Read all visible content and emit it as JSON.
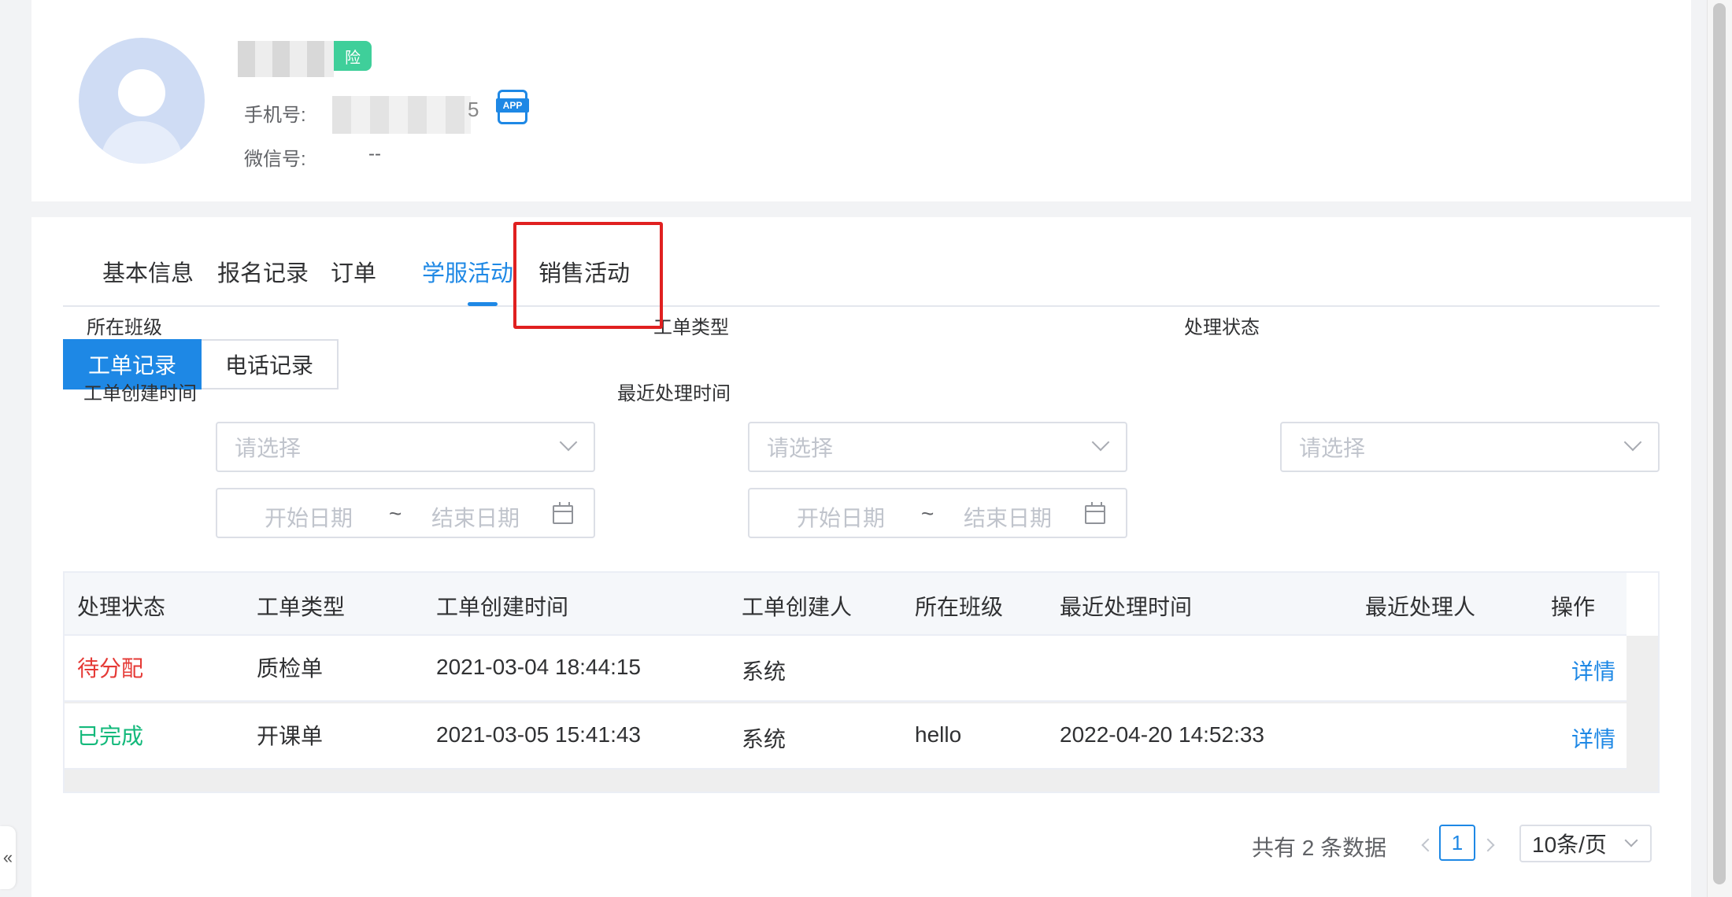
{
  "profile": {
    "name_badge": "险",
    "phone_label": "手机号:",
    "phone_tail": "5",
    "app_badge": "APP",
    "wechat_label": "微信号:",
    "wechat_value": "--"
  },
  "tabs": [
    {
      "label": "基本信息",
      "active": false
    },
    {
      "label": "报名记录",
      "active": false
    },
    {
      "label": "订单",
      "active": false
    },
    {
      "label": "学服活动",
      "active": true
    },
    {
      "label": "销售活动",
      "active": false
    }
  ],
  "segments": [
    {
      "label": "工单记录",
      "active": true
    },
    {
      "label": "电话记录",
      "active": false
    }
  ],
  "filters": {
    "class_label": "所在班级",
    "class_placeholder": "请选择",
    "type_label": "工单类型",
    "type_placeholder": "请选择",
    "status_label": "处理状态",
    "status_placeholder": "请选择",
    "created_label": "工单创建时间",
    "recent_label": "最近处理时间",
    "start_placeholder": "开始日期",
    "separator": "~",
    "end_placeholder": "结束日期"
  },
  "table": {
    "headers": [
      "处理状态",
      "工单类型",
      "工单创建时间",
      "工单创建人",
      "所在班级",
      "最近处理时间",
      "最近处理人",
      "操作"
    ],
    "rows": [
      {
        "status": "待分配",
        "type": "质检单",
        "created": "2021-03-04 18:44:15",
        "creator": "系统",
        "class": "",
        "recent_time": "",
        "recent_user": "",
        "action": "详情"
      },
      {
        "status": "已完成",
        "type": "开课单",
        "created": "2021-03-05 15:41:43",
        "creator": "系统",
        "class": "hello",
        "recent_time": "2022-04-20 14:52:33",
        "recent_user": "",
        "action": "详情"
      }
    ]
  },
  "pagination": {
    "total": "共有 2 条数据",
    "current_page": "1",
    "page_size": "10条/页"
  },
  "collapse_glyph": "«",
  "colors": {
    "accent": "#1e88e5",
    "pending": "#e53935",
    "done": "#13b97b",
    "highlight": "#e02020"
  }
}
